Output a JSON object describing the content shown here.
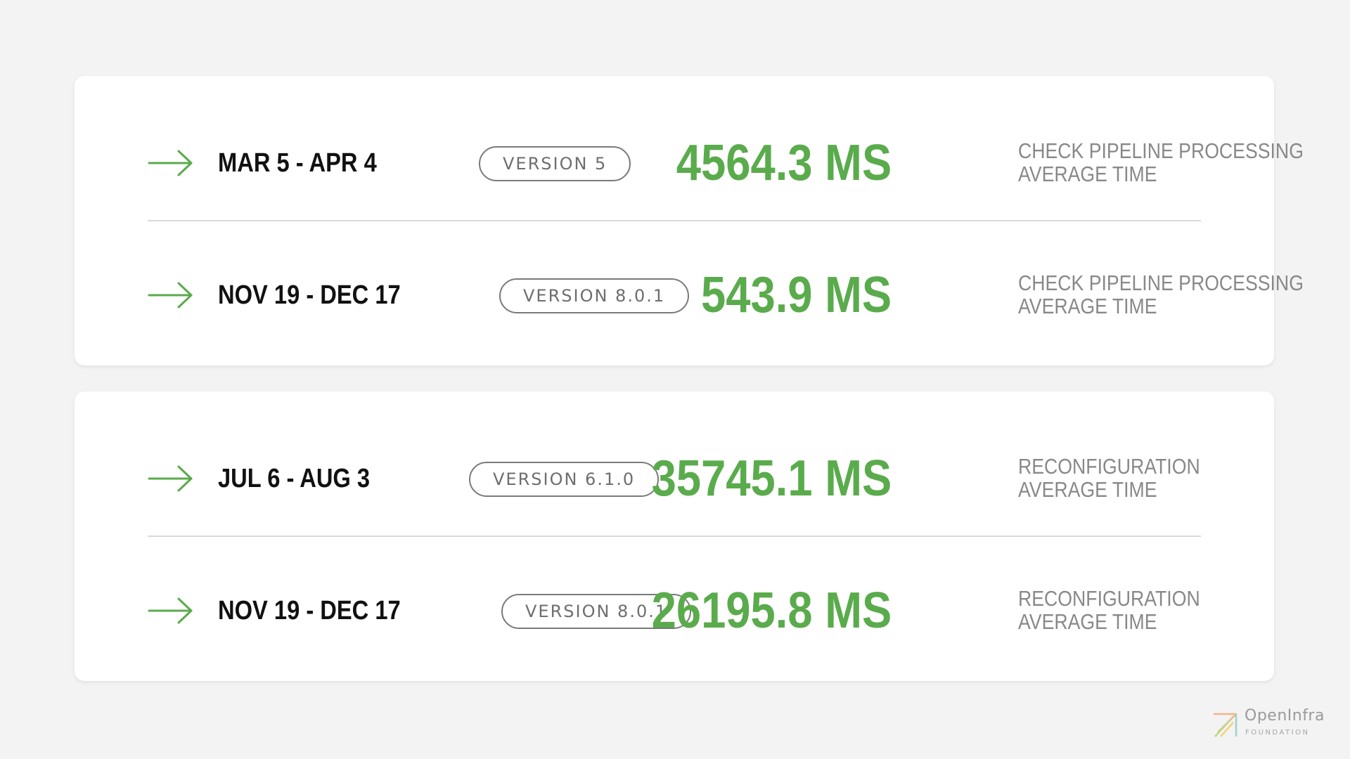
{
  "colors": {
    "background": "#f3f3f3",
    "card": "#ffffff",
    "accent_green": "#5aab4c",
    "date_text": "#111111",
    "badge_text": "#6e6e6e",
    "description_text": "#888888"
  },
  "cards": [
    {
      "rows": [
        {
          "date_range": "MAR 5 - APR 4",
          "version": "VERSION 5",
          "metric": "4564.3 MS",
          "description_line1": "CHECK PIPELINE PROCESSING",
          "description_line2": "AVERAGE TIME",
          "icon": "arrow-right-icon"
        },
        {
          "date_range": "NOV 19 - DEC 17",
          "version": "VERSION 8.0.1",
          "metric": "543.9 MS",
          "description_line1": "CHECK PIPELINE PROCESSING",
          "description_line2": "AVERAGE TIME",
          "icon": "arrow-right-icon"
        }
      ]
    },
    {
      "rows": [
        {
          "date_range": "JUL 6 - AUG 3",
          "version": "VERSION 6.1.0",
          "metric": "35745.1 MS",
          "description_line1": "RECONFIGURATION",
          "description_line2": "AVERAGE TIME",
          "icon": "arrow-right-icon"
        },
        {
          "date_range": "NOV 19 - DEC 17",
          "version": "VERSION 8.0.1",
          "metric": "26195.8 MS",
          "description_line1": "RECONFIGURATION",
          "description_line2": "AVERAGE TIME",
          "icon": "arrow-right-icon"
        }
      ]
    }
  ],
  "logo": {
    "name": "OpenInfra",
    "subtitle": "FOUNDATION",
    "icon": "openinfra-logo-icon"
  }
}
